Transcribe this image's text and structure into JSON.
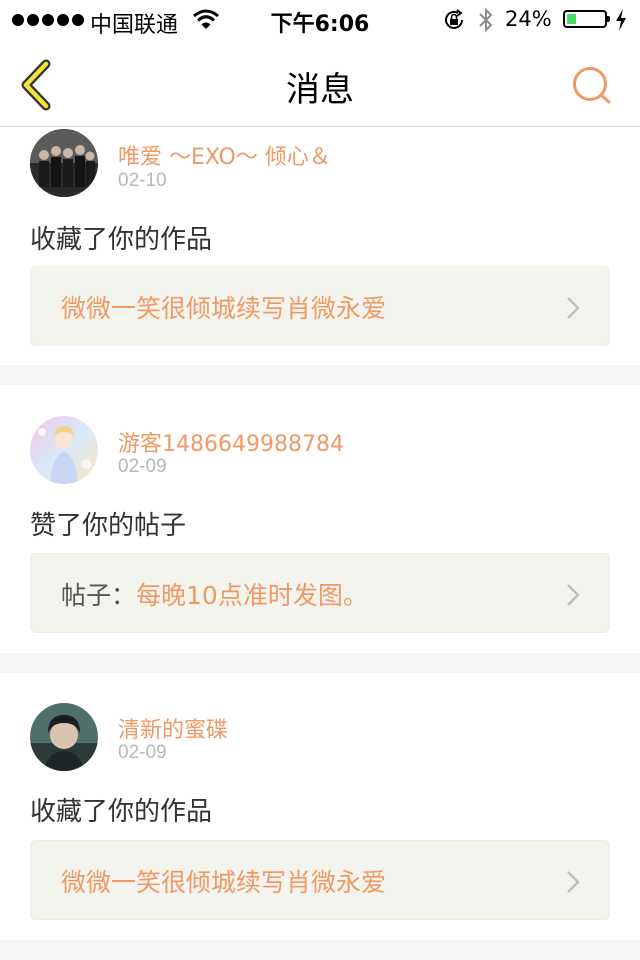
{
  "status_bar": {
    "carrier": "中国联通",
    "time": "下午6:06",
    "battery_percent_text": "24%",
    "battery_level": 0.24,
    "battery_color": "#4cd964"
  },
  "nav": {
    "title": "消息",
    "back_icon": "chevron-left-icon",
    "search_icon": "search-icon",
    "accent_color": "#ef9a66"
  },
  "messages": [
    {
      "username": "唯爱 ～EXO～ 倾心＆",
      "date": "02-10",
      "action": "收藏了你的作品",
      "link_prefix": "",
      "link_value": "微微一笑很倾城续写肖微永爱"
    },
    {
      "username": "游客1486649988784",
      "date": "02-09",
      "action": "赞了你的帖子",
      "link_prefix": "帖子：",
      "link_value": "每晚10点准时发图。"
    },
    {
      "username": "清新的蜜碟",
      "date": "02-09",
      "action": "收藏了你的作品",
      "link_prefix": "",
      "link_value": "微微一笑很倾城续写肖微永爱"
    }
  ]
}
